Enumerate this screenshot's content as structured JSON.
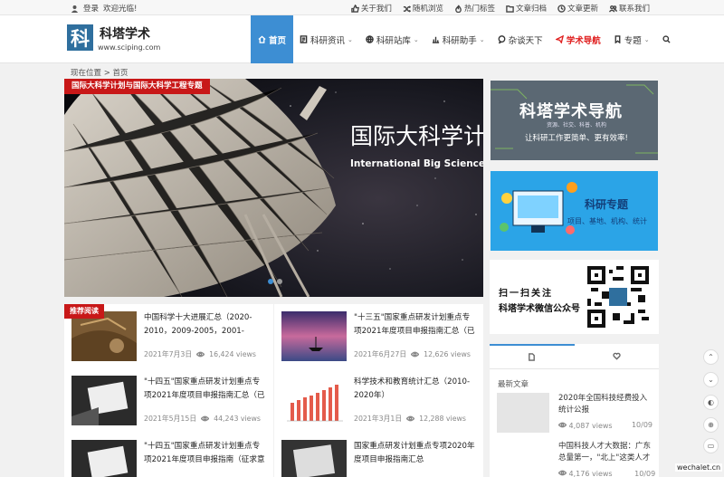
{
  "topbar": {
    "login": "登录",
    "welcome": "欢迎光临!",
    "links": [
      "关于我们",
      "随机浏览",
      "热门标签",
      "文章归档",
      "文章更新",
      "联系我们"
    ]
  },
  "header": {
    "logo_char": "科",
    "site_name": "科塔学术",
    "site_url": "www.sciping.com"
  },
  "nav": {
    "home": "首页",
    "items": [
      "科研资讯",
      "科研站库",
      "科研助手",
      "杂谈天下"
    ],
    "nav_academic": "学术导航",
    "topics": "专题"
  },
  "breadcrumb": {
    "here": "现在位置",
    "sep": ">",
    "home": "首页"
  },
  "slider": {
    "tag": "国际大科学计划与国际大科学工程专题",
    "heading_cn": "国际大科学计",
    "heading_en": "International Big Science Re"
  },
  "sidebar": {
    "nav_title": "科塔学术导航",
    "nav_sub": "资源、社交、科普、机构",
    "nav_slogan": "让科研工作更简单、更有效率!",
    "topic_title": "科研专题",
    "topic_sub": "项目、基地、机构、统计",
    "qr_line1": "扫一扫关注",
    "qr_line2": "科塔学术微信公众号",
    "tab_latest": "最新文章",
    "latest": [
      {
        "title": "2020年全国科技经费投入统计公报",
        "views": "4,087 views",
        "date": "10/09"
      },
      {
        "title": "中国科技人才大数据：广东总量第一，\"北上\"这类人才",
        "views": "4,176 views",
        "date": "10/09"
      }
    ]
  },
  "recommend_badge": "推荐阅读",
  "articles": [
    {
      "title": "中国科学十大进展汇总（2020-2010，2009-2005，2001-1998）",
      "date": "2021年7月3日",
      "views": "16,424 views"
    },
    {
      "title": "\"十三五\"国家重点研发计划重点专项2021年度项目申报指南汇总（已",
      "date": "2021年6月27日",
      "views": "12,626 views"
    },
    {
      "title": "\"十四五\"国家重点研发计划重点专项2021年度项目申报指南汇总（已",
      "date": "2021年5月15日",
      "views": "44,243 views"
    },
    {
      "title": "科学技术和教育统计汇总（2010-2020年）",
      "date": "2021年3月1日",
      "views": "12,288 views"
    },
    {
      "title": "\"十四五\"国家重点研发计划重点专项2021年度项目申报指南（征求意",
      "date": "",
      "views": ""
    },
    {
      "title": "国家重点研发计划重点专项2020年度项目申报指南汇总",
      "date": "",
      "views": ""
    }
  ],
  "watermark": "wechalet.cn",
  "colors": {
    "accent": "#3d8ed3",
    "badge": "#c81818",
    "nav_highlight": "#e02020"
  }
}
